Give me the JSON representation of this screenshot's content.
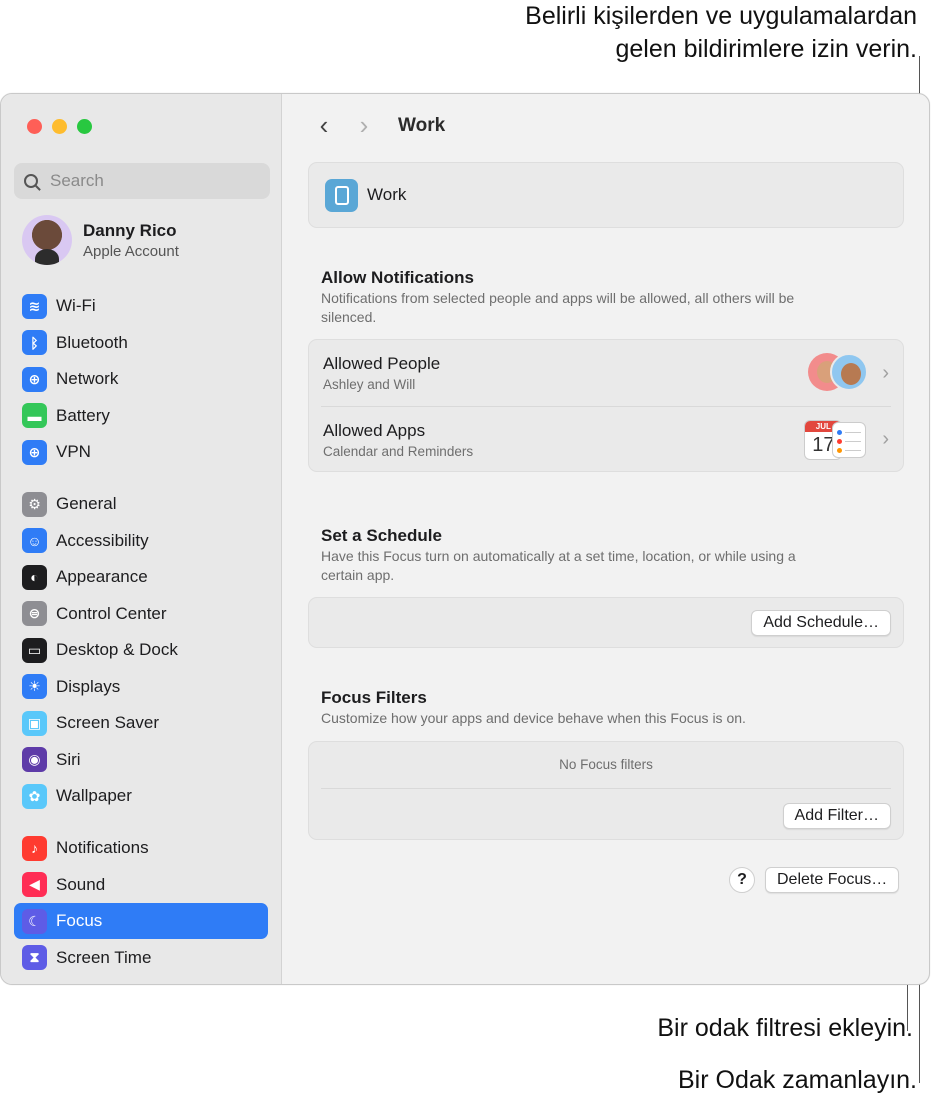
{
  "callouts": {
    "top_line1": "Belirli kişilerden ve uygulamalardan",
    "top_line2": "gelen bildirimlere izin verin.",
    "add_filter": "Bir odak filtresi ekleyin.",
    "schedule": "Bir Odak zamanlayın."
  },
  "sidebar": {
    "search_placeholder": "Search",
    "account": {
      "name": "Danny Rico",
      "subtitle": "Apple Account"
    },
    "groups": [
      [
        {
          "label": "Wi-Fi",
          "icon": "wifi-icon",
          "color": "#2f7cf6"
        },
        {
          "label": "Bluetooth",
          "icon": "bluetooth-icon",
          "color": "#2f7cf6"
        },
        {
          "label": "Network",
          "icon": "globe-icon",
          "color": "#2f7cf6"
        },
        {
          "label": "Battery",
          "icon": "battery-icon",
          "color": "#34c759"
        },
        {
          "label": "VPN",
          "icon": "vpn-globe-icon",
          "color": "#2f7cf6"
        }
      ],
      [
        {
          "label": "General",
          "icon": "gear-icon",
          "color": "#8e8e93"
        },
        {
          "label": "Accessibility",
          "icon": "accessibility-icon",
          "color": "#2f7cf6"
        },
        {
          "label": "Appearance",
          "icon": "appearance-icon",
          "color": "#1d1d1f"
        },
        {
          "label": "Control Center",
          "icon": "toggles-icon",
          "color": "#8e8e93"
        },
        {
          "label": "Desktop & Dock",
          "icon": "dock-icon",
          "color": "#1d1d1f"
        },
        {
          "label": "Displays",
          "icon": "sun-icon",
          "color": "#2f7cf6"
        },
        {
          "label": "Screen Saver",
          "icon": "screensaver-icon",
          "color": "#5ac8fa"
        },
        {
          "label": "Siri",
          "icon": "siri-icon",
          "color": "#5e3ba8"
        },
        {
          "label": "Wallpaper",
          "icon": "flower-icon",
          "color": "#5ac8fa"
        }
      ],
      [
        {
          "label": "Notifications",
          "icon": "bell-icon",
          "color": "#ff3b30"
        },
        {
          "label": "Sound",
          "icon": "speaker-icon",
          "color": "#ff2d55"
        },
        {
          "label": "Focus",
          "icon": "moon-icon",
          "color": "#5e5ce6",
          "selected": true
        },
        {
          "label": "Screen Time",
          "icon": "hourglass-icon",
          "color": "#5e5ce6"
        }
      ]
    ]
  },
  "toolbar": {
    "title": "Work"
  },
  "focus": {
    "name": "Work",
    "allow": {
      "title": "Allow Notifications",
      "desc": "Notifications from selected people and apps will be allowed, all others will be silenced.",
      "people": {
        "title": "Allowed People",
        "sub": "Ashley and Will"
      },
      "apps": {
        "title": "Allowed Apps",
        "sub": "Calendar and Reminders",
        "cal_month": "JUL",
        "cal_day": "17"
      }
    },
    "schedule": {
      "title": "Set a Schedule",
      "desc": "Have this Focus turn on automatically at a set time, location, or while using a certain app.",
      "button": "Add Schedule…"
    },
    "filters": {
      "title": "Focus Filters",
      "desc": "Customize how your apps and device behave when this Focus is on.",
      "empty": "No Focus filters",
      "button": "Add Filter…"
    },
    "help": "?",
    "delete_button": "Delete Focus…"
  }
}
